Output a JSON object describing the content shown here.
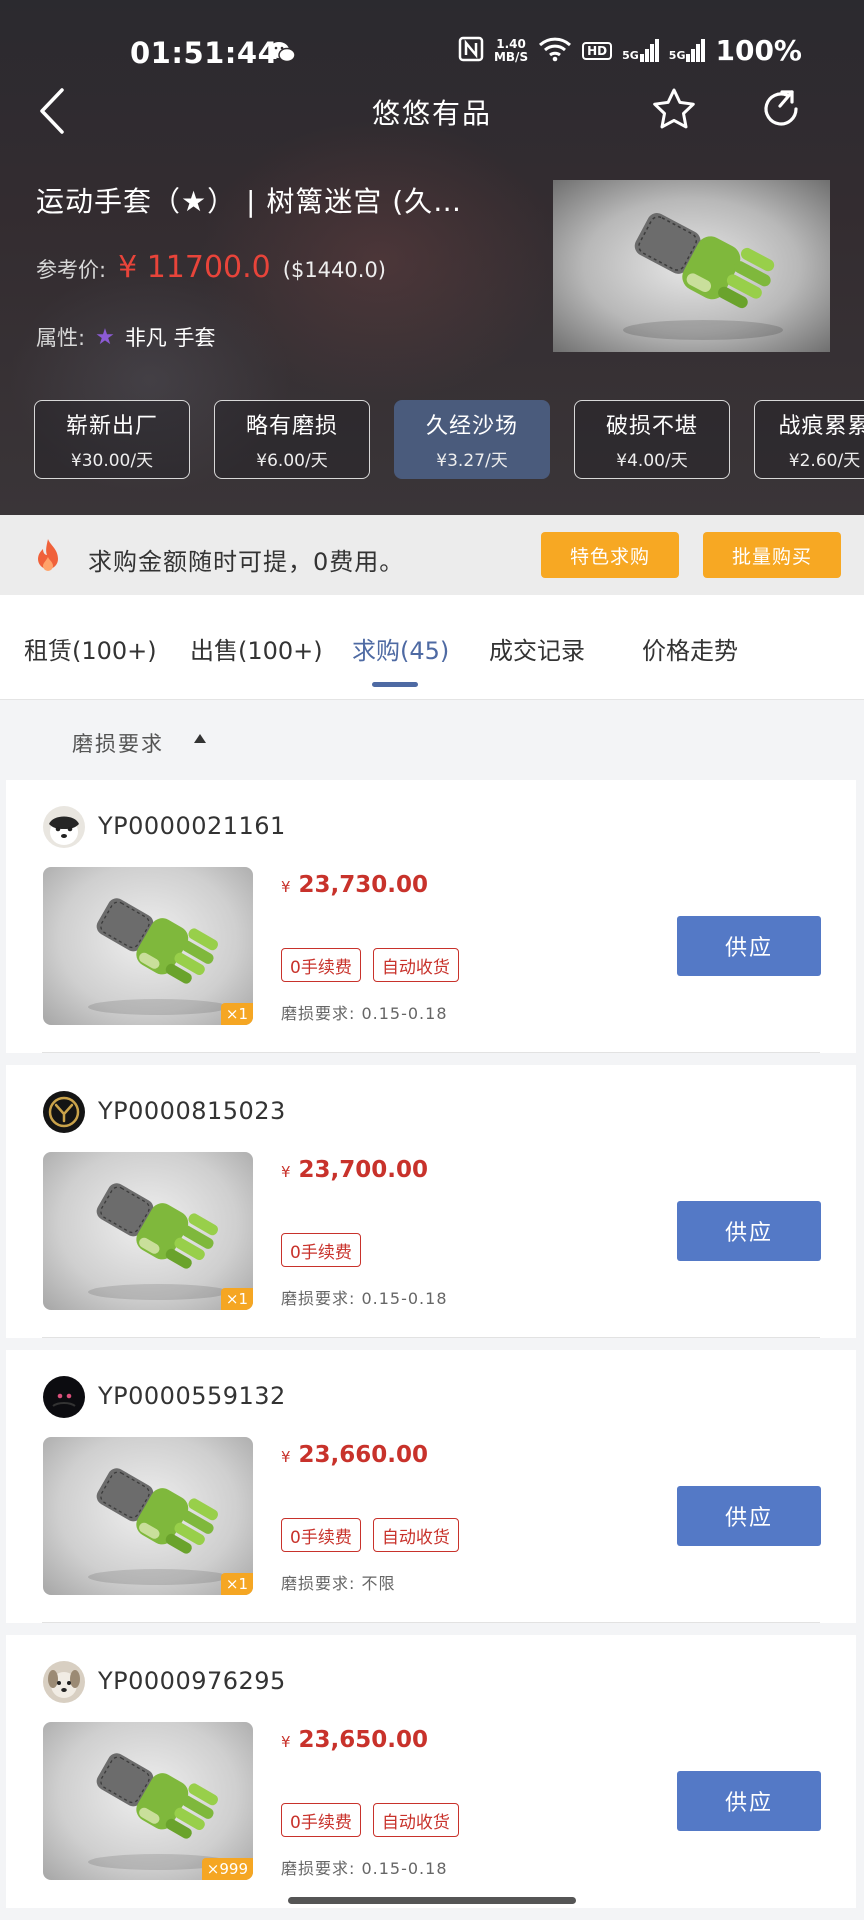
{
  "status_bar": {
    "time": "01:51:44",
    "net_speed_value": "1.40",
    "net_speed_unit": "MB/S",
    "hd": "HD",
    "sim1": "5G",
    "sim2": "5G",
    "battery": "100%"
  },
  "nav": {
    "title": "悠悠有品",
    "back_icon": "chevron-left-icon",
    "favorite_icon": "star-outline-icon",
    "share_icon": "share-arrow-icon"
  },
  "item": {
    "title": "运动手套（★） | 树篱迷宫 (久…",
    "price_label": "参考价:",
    "price": "¥ 11700.0",
    "price_usd": "($1440.0)",
    "attr_label": "属性:",
    "attr_value": "非凡 手套"
  },
  "wear_options": [
    {
      "name": "崭新出厂",
      "price": "¥30.00/天",
      "active": false
    },
    {
      "name": "略有磨损",
      "price": "¥6.00/天",
      "active": false
    },
    {
      "name": "久经沙场",
      "price": "¥3.27/天",
      "active": true
    },
    {
      "name": "破损不堪",
      "price": "¥4.00/天",
      "active": false
    },
    {
      "name": "战痕累累",
      "price": "¥2.60/天",
      "active": false
    }
  ],
  "notice": {
    "text": "求购金额随时可提，0费用。",
    "button_special": "特色求购",
    "button_bulk": "批量购买"
  },
  "tabs": [
    {
      "label": "租赁(100+)",
      "active": false
    },
    {
      "label": "出售(100+)",
      "active": false
    },
    {
      "label": "求购(45)",
      "active": true
    },
    {
      "label": "成交记录",
      "active": false
    },
    {
      "label": "价格走势",
      "active": false
    }
  ],
  "filter": {
    "label": "磨损要求"
  },
  "currency_symbol": "¥",
  "supply_label": "供应",
  "orders": [
    {
      "user": "YP0000021161",
      "price": "23,730.00",
      "tags": [
        "0手续费",
        "自动收货"
      ],
      "wear_req": "磨损要求: 0.15-0.18",
      "qty": "×1"
    },
    {
      "user": "YP0000815023",
      "price": "23,700.00",
      "tags": [
        "0手续费"
      ],
      "wear_req": "磨损要求: 0.15-0.18",
      "qty": "×1"
    },
    {
      "user": "YP0000559132",
      "price": "23,660.00",
      "tags": [
        "0手续费",
        "自动收货"
      ],
      "wear_req": "磨损要求: 不限",
      "qty": "×1"
    },
    {
      "user": "YP0000976295",
      "price": "23,650.00",
      "tags": [
        "0手续费",
        "自动收货"
      ],
      "wear_req": "磨损要求: 0.15-0.18",
      "qty": "×999"
    }
  ]
}
